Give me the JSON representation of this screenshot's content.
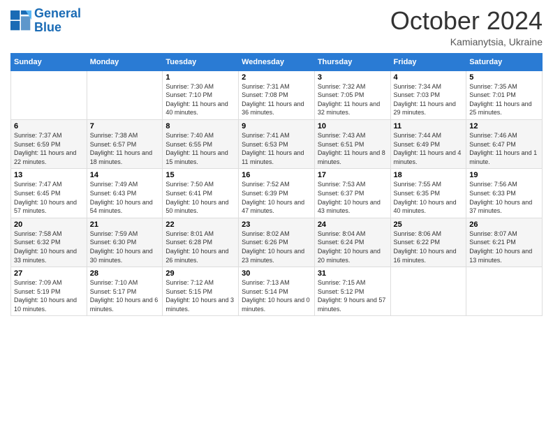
{
  "logo": {
    "line1": "General",
    "line2": "Blue"
  },
  "header": {
    "month": "October 2024",
    "location": "Kamianytsia, Ukraine"
  },
  "weekdays": [
    "Sunday",
    "Monday",
    "Tuesday",
    "Wednesday",
    "Thursday",
    "Friday",
    "Saturday"
  ],
  "weeks": [
    [
      {
        "day": "",
        "sunrise": "",
        "sunset": "",
        "daylight": ""
      },
      {
        "day": "",
        "sunrise": "",
        "sunset": "",
        "daylight": ""
      },
      {
        "day": "1",
        "sunrise": "Sunrise: 7:30 AM",
        "sunset": "Sunset: 7:10 PM",
        "daylight": "Daylight: 11 hours and 40 minutes."
      },
      {
        "day": "2",
        "sunrise": "Sunrise: 7:31 AM",
        "sunset": "Sunset: 7:08 PM",
        "daylight": "Daylight: 11 hours and 36 minutes."
      },
      {
        "day": "3",
        "sunrise": "Sunrise: 7:32 AM",
        "sunset": "Sunset: 7:05 PM",
        "daylight": "Daylight: 11 hours and 32 minutes."
      },
      {
        "day": "4",
        "sunrise": "Sunrise: 7:34 AM",
        "sunset": "Sunset: 7:03 PM",
        "daylight": "Daylight: 11 hours and 29 minutes."
      },
      {
        "day": "5",
        "sunrise": "Sunrise: 7:35 AM",
        "sunset": "Sunset: 7:01 PM",
        "daylight": "Daylight: 11 hours and 25 minutes."
      }
    ],
    [
      {
        "day": "6",
        "sunrise": "Sunrise: 7:37 AM",
        "sunset": "Sunset: 6:59 PM",
        "daylight": "Daylight: 11 hours and 22 minutes."
      },
      {
        "day": "7",
        "sunrise": "Sunrise: 7:38 AM",
        "sunset": "Sunset: 6:57 PM",
        "daylight": "Daylight: 11 hours and 18 minutes."
      },
      {
        "day": "8",
        "sunrise": "Sunrise: 7:40 AM",
        "sunset": "Sunset: 6:55 PM",
        "daylight": "Daylight: 11 hours and 15 minutes."
      },
      {
        "day": "9",
        "sunrise": "Sunrise: 7:41 AM",
        "sunset": "Sunset: 6:53 PM",
        "daylight": "Daylight: 11 hours and 11 minutes."
      },
      {
        "day": "10",
        "sunrise": "Sunrise: 7:43 AM",
        "sunset": "Sunset: 6:51 PM",
        "daylight": "Daylight: 11 hours and 8 minutes."
      },
      {
        "day": "11",
        "sunrise": "Sunrise: 7:44 AM",
        "sunset": "Sunset: 6:49 PM",
        "daylight": "Daylight: 11 hours and 4 minutes."
      },
      {
        "day": "12",
        "sunrise": "Sunrise: 7:46 AM",
        "sunset": "Sunset: 6:47 PM",
        "daylight": "Daylight: 11 hours and 1 minute."
      }
    ],
    [
      {
        "day": "13",
        "sunrise": "Sunrise: 7:47 AM",
        "sunset": "Sunset: 6:45 PM",
        "daylight": "Daylight: 10 hours and 57 minutes."
      },
      {
        "day": "14",
        "sunrise": "Sunrise: 7:49 AM",
        "sunset": "Sunset: 6:43 PM",
        "daylight": "Daylight: 10 hours and 54 minutes."
      },
      {
        "day": "15",
        "sunrise": "Sunrise: 7:50 AM",
        "sunset": "Sunset: 6:41 PM",
        "daylight": "Daylight: 10 hours and 50 minutes."
      },
      {
        "day": "16",
        "sunrise": "Sunrise: 7:52 AM",
        "sunset": "Sunset: 6:39 PM",
        "daylight": "Daylight: 10 hours and 47 minutes."
      },
      {
        "day": "17",
        "sunrise": "Sunrise: 7:53 AM",
        "sunset": "Sunset: 6:37 PM",
        "daylight": "Daylight: 10 hours and 43 minutes."
      },
      {
        "day": "18",
        "sunrise": "Sunrise: 7:55 AM",
        "sunset": "Sunset: 6:35 PM",
        "daylight": "Daylight: 10 hours and 40 minutes."
      },
      {
        "day": "19",
        "sunrise": "Sunrise: 7:56 AM",
        "sunset": "Sunset: 6:33 PM",
        "daylight": "Daylight: 10 hours and 37 minutes."
      }
    ],
    [
      {
        "day": "20",
        "sunrise": "Sunrise: 7:58 AM",
        "sunset": "Sunset: 6:32 PM",
        "daylight": "Daylight: 10 hours and 33 minutes."
      },
      {
        "day": "21",
        "sunrise": "Sunrise: 7:59 AM",
        "sunset": "Sunset: 6:30 PM",
        "daylight": "Daylight: 10 hours and 30 minutes."
      },
      {
        "day": "22",
        "sunrise": "Sunrise: 8:01 AM",
        "sunset": "Sunset: 6:28 PM",
        "daylight": "Daylight: 10 hours and 26 minutes."
      },
      {
        "day": "23",
        "sunrise": "Sunrise: 8:02 AM",
        "sunset": "Sunset: 6:26 PM",
        "daylight": "Daylight: 10 hours and 23 minutes."
      },
      {
        "day": "24",
        "sunrise": "Sunrise: 8:04 AM",
        "sunset": "Sunset: 6:24 PM",
        "daylight": "Daylight: 10 hours and 20 minutes."
      },
      {
        "day": "25",
        "sunrise": "Sunrise: 8:06 AM",
        "sunset": "Sunset: 6:22 PM",
        "daylight": "Daylight: 10 hours and 16 minutes."
      },
      {
        "day": "26",
        "sunrise": "Sunrise: 8:07 AM",
        "sunset": "Sunset: 6:21 PM",
        "daylight": "Daylight: 10 hours and 13 minutes."
      }
    ],
    [
      {
        "day": "27",
        "sunrise": "Sunrise: 7:09 AM",
        "sunset": "Sunset: 5:19 PM",
        "daylight": "Daylight: 10 hours and 10 minutes."
      },
      {
        "day": "28",
        "sunrise": "Sunrise: 7:10 AM",
        "sunset": "Sunset: 5:17 PM",
        "daylight": "Daylight: 10 hours and 6 minutes."
      },
      {
        "day": "29",
        "sunrise": "Sunrise: 7:12 AM",
        "sunset": "Sunset: 5:15 PM",
        "daylight": "Daylight: 10 hours and 3 minutes."
      },
      {
        "day": "30",
        "sunrise": "Sunrise: 7:13 AM",
        "sunset": "Sunset: 5:14 PM",
        "daylight": "Daylight: 10 hours and 0 minutes."
      },
      {
        "day": "31",
        "sunrise": "Sunrise: 7:15 AM",
        "sunset": "Sunset: 5:12 PM",
        "daylight": "Daylight: 9 hours and 57 minutes."
      },
      {
        "day": "",
        "sunrise": "",
        "sunset": "",
        "daylight": ""
      },
      {
        "day": "",
        "sunrise": "",
        "sunset": "",
        "daylight": ""
      }
    ]
  ]
}
